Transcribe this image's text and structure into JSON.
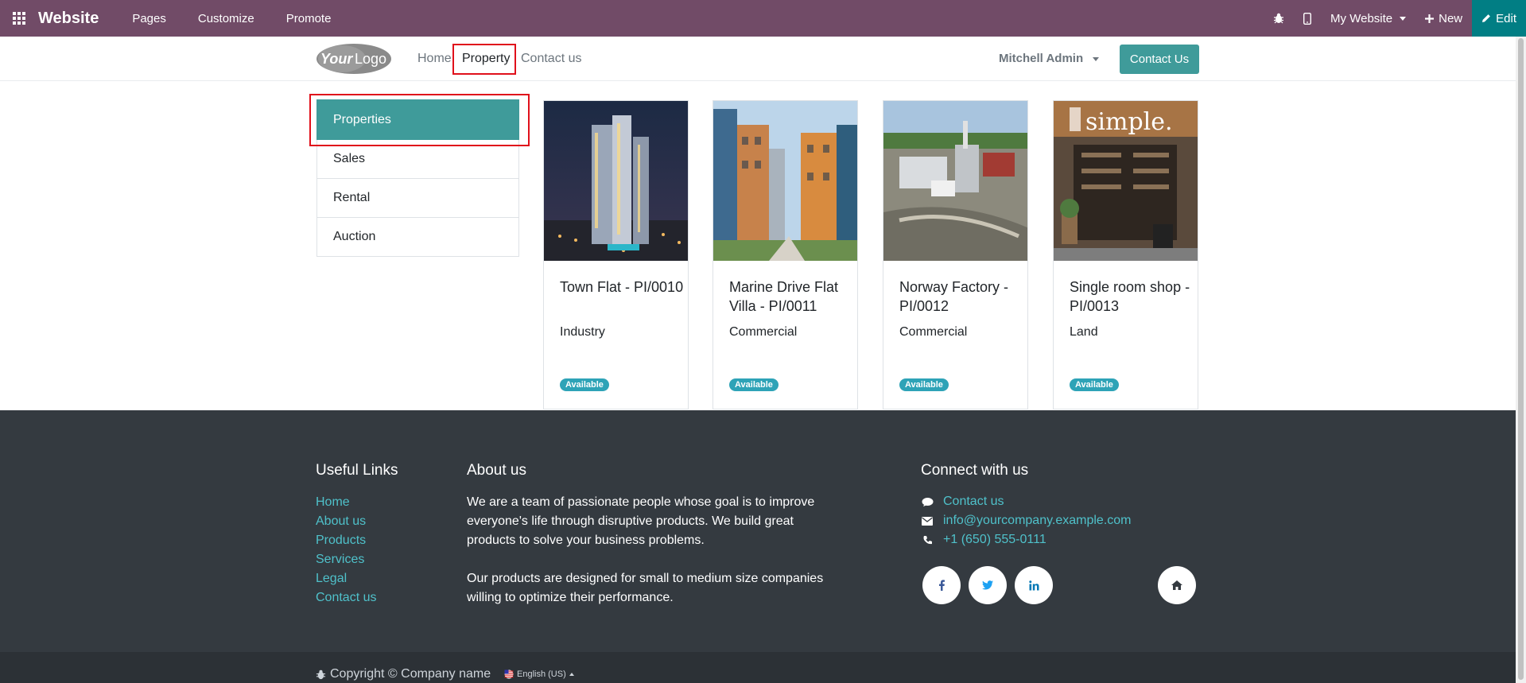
{
  "admin_bar": {
    "brand": "Website",
    "menu": [
      "Pages",
      "Customize",
      "Promote"
    ],
    "website_selector": "My Website",
    "new_label": "New",
    "edit_label": "Edit"
  },
  "nav": {
    "logo_text": "YourLogo",
    "links": [
      "Home",
      "Property",
      "Contact us"
    ],
    "user": "Mitchell Admin",
    "contact_button": "Contact Us"
  },
  "sidebar": {
    "items": [
      "Properties",
      "Sales",
      "Rental",
      "Auction"
    ]
  },
  "properties": [
    {
      "title": "Town Flat - PI/0010",
      "type": "Industry",
      "status": "Available"
    },
    {
      "title": "Marine Drive Flat Villa - PI/0011",
      "type": "Commercial",
      "status": "Available"
    },
    {
      "title": "Norway Factory - PI/0012",
      "type": "Commercial",
      "status": "Available"
    },
    {
      "title": "Single room shop - PI/0013",
      "type": "Land",
      "status": "Available"
    }
  ],
  "footer": {
    "useful_links_title": "Useful Links",
    "useful_links": [
      "Home",
      "About us",
      "Products",
      "Services",
      "Legal",
      "Contact us"
    ],
    "about_title": "About us",
    "about_p1": "We are a team of passionate people whose goal is to improve everyone's life through disruptive products. We build great products to solve your business problems.",
    "about_p2": "Our products are designed for small to medium size companies willing to optimize their performance.",
    "connect_title": "Connect with us",
    "contact_link": "Contact us",
    "email": "info@yourcompany.example.com",
    "phone": "+1 (650) 555-0111",
    "shop_sign": "simple.",
    "copyright": "Copyright © Company name",
    "language": "English (US)"
  },
  "colors": {
    "admin_bar": "#714b67",
    "primary": "#3f9b9a",
    "badge": "#2ea3b7",
    "footer": "#343a40",
    "highlight": "#e0101b"
  }
}
